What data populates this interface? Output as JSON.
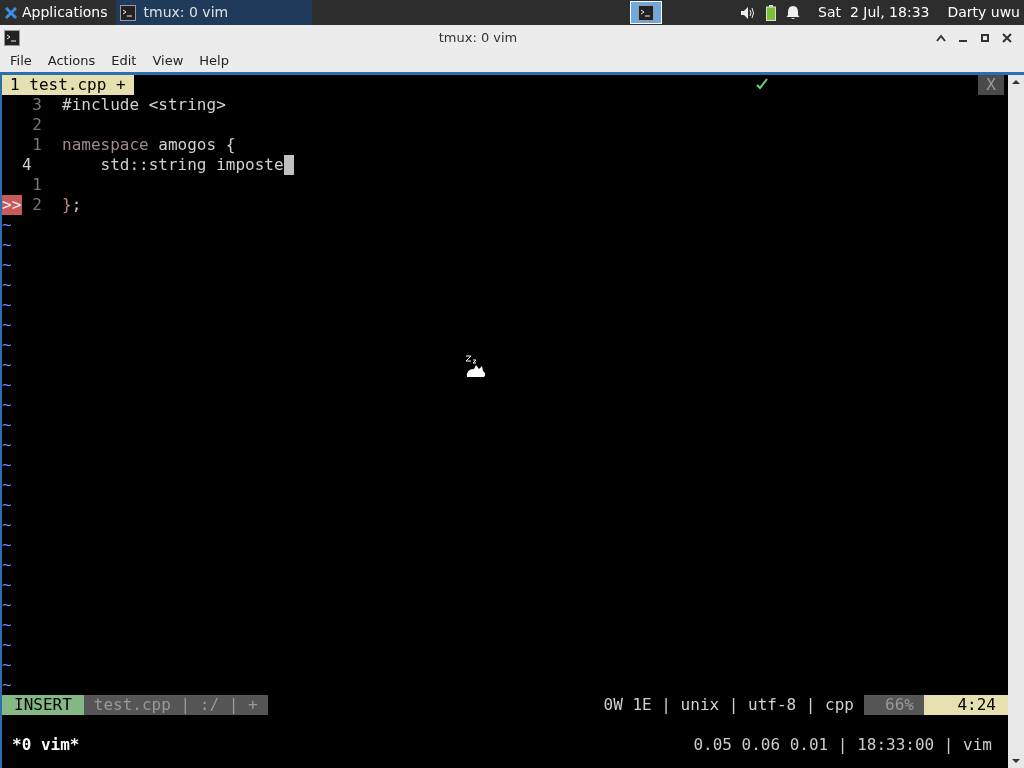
{
  "top_panel": {
    "applications": "Applications",
    "tasks": [
      {
        "label": "tmux: 0 vim",
        "selected": true
      }
    ],
    "clock": "Sat  2 Jul, 18:33",
    "user": "Darty uwu"
  },
  "window": {
    "title": "tmux: 0 vim",
    "menu": [
      "File",
      "Actions",
      "Edit",
      "View",
      "Help"
    ]
  },
  "vim": {
    "tab": "1 test.cpp +",
    "close": "X",
    "lines": [
      {
        "number": "3",
        "current": false,
        "segments": [
          {
            "kind": "normal",
            "text": "#include <string>"
          }
        ]
      },
      {
        "number": "2",
        "current": false
      },
      {
        "number": "1",
        "current": false,
        "segments": [
          {
            "kind": "keyword",
            "text": "namespace"
          },
          {
            "kind": "normal",
            "text": " amogos {"
          }
        ]
      },
      {
        "number": "4",
        "current": true,
        "segments": [
          {
            "kind": "normal",
            "text": "    std::string imposte"
          }
        ],
        "cursor": true
      },
      {
        "number": "1",
        "current": false
      },
      {
        "number": "2",
        "current": false,
        "sign": ">>",
        "segments": [
          {
            "kind": "error",
            "text": "}"
          },
          {
            "kind": "normal",
            "text": ";"
          }
        ]
      }
    ],
    "empty_lines": [
      "~",
      "~",
      "~",
      "~",
      "~",
      "~",
      "~",
      "~",
      "~",
      "~",
      "~",
      "~",
      "~",
      "~",
      "~",
      "~",
      "~",
      "~",
      "~",
      "~",
      "~",
      "~",
      "~",
      "~"
    ],
    "status": {
      "mode": "INSERT",
      "file": "test.cpp | :/ | +",
      "info": "0W 1E | unix | utf-8 | cpp",
      "percent": "66%",
      "position": "4:24"
    }
  },
  "tmux": {
    "window": "*0 vim*",
    "right": "0.05 0.06 0.01 | 18:33:00 | vim"
  }
}
